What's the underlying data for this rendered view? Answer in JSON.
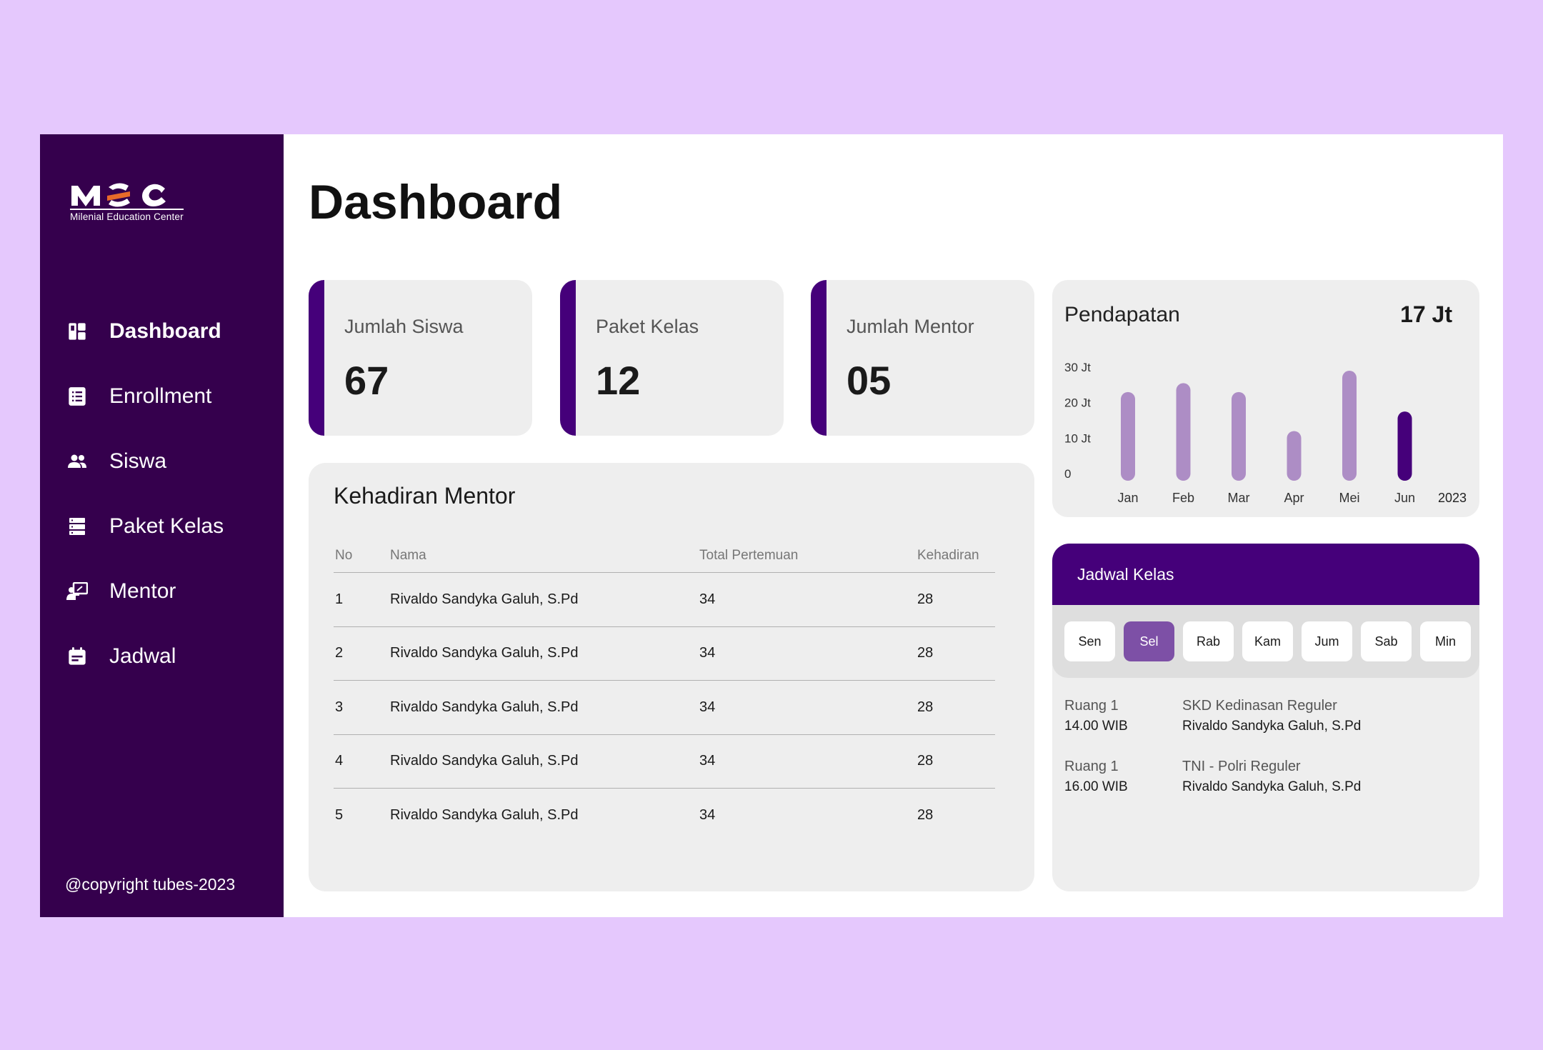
{
  "brand": {
    "logo_text": "MEC",
    "tagline": "Milenial Education Center"
  },
  "sidebar": {
    "items": [
      {
        "label": "Dashboard",
        "icon": "dashboard-icon",
        "active": true
      },
      {
        "label": "Enrollment",
        "icon": "document-list-icon",
        "active": false
      },
      {
        "label": "Siswa",
        "icon": "people-icon",
        "active": false
      },
      {
        "label": "Paket Kelas",
        "icon": "storage-stack-icon",
        "active": false
      },
      {
        "label": "Mentor",
        "icon": "presenter-icon",
        "active": false
      },
      {
        "label": "Jadwal",
        "icon": "calendar-event-icon",
        "active": false
      }
    ],
    "copyright": "@copyright tubes-2023"
  },
  "page": {
    "title": "Dashboard"
  },
  "stats": [
    {
      "label": "Jumlah Siswa",
      "value": "67"
    },
    {
      "label": "Paket Kelas",
      "value": "12"
    },
    {
      "label": "Jumlah Mentor",
      "value": "05"
    }
  ],
  "revenue": {
    "title": "Pendapatan",
    "total": "17 Jt"
  },
  "chart_data": {
    "type": "bar",
    "categories": [
      "Jan",
      "Feb",
      "Mar",
      "Apr",
      "Mei",
      "Jun"
    ],
    "values": [
      25,
      27.5,
      25,
      14,
      31,
      19.5
    ],
    "highlight_index": 5,
    "y_ticks": [
      "0",
      "10 Jt",
      "20 Jt",
      "30 Jt"
    ],
    "ylim": [
      0,
      30
    ],
    "year_label": "2023",
    "grid": false,
    "colors": {
      "bar": "#ad8dc5",
      "highlight": "#45007a"
    }
  },
  "attendance": {
    "title": "Kehadiran Mentor",
    "columns": [
      "No",
      "Nama",
      "Total Pertemuan",
      "Kehadiran"
    ],
    "rows": [
      [
        "1",
        "Rivaldo Sandyka Galuh, S.Pd",
        "34",
        "28"
      ],
      [
        "2",
        "Rivaldo Sandyka Galuh, S.Pd",
        "34",
        "28"
      ],
      [
        "3",
        "Rivaldo Sandyka Galuh, S.Pd",
        "34",
        "28"
      ],
      [
        "4",
        "Rivaldo Sandyka Galuh, S.Pd",
        "34",
        "28"
      ],
      [
        "5",
        "Rivaldo Sandyka Galuh, S.Pd",
        "34",
        "28"
      ]
    ]
  },
  "schedule": {
    "title": "Jadwal Kelas",
    "days": [
      "Sen",
      "Sel",
      "Rab",
      "Kam",
      "Jum",
      "Sab",
      "Min"
    ],
    "active_day": "Sel",
    "items": [
      {
        "room": "Ruang 1",
        "time": "14.00 WIB",
        "class": "SKD Kedinasan Reguler",
        "mentor": "Rivaldo Sandyka Galuh, S.Pd"
      },
      {
        "room": "Ruang 1",
        "time": "16.00 WIB",
        "class": "TNI - Polri Reguler",
        "mentor": "Rivaldo Sandyka Galuh, S.Pd"
      }
    ]
  },
  "colors": {
    "background": "#e5c8fd",
    "sidebar": "#35004d",
    "accent": "#45007a",
    "day_active": "#7d50a6"
  }
}
